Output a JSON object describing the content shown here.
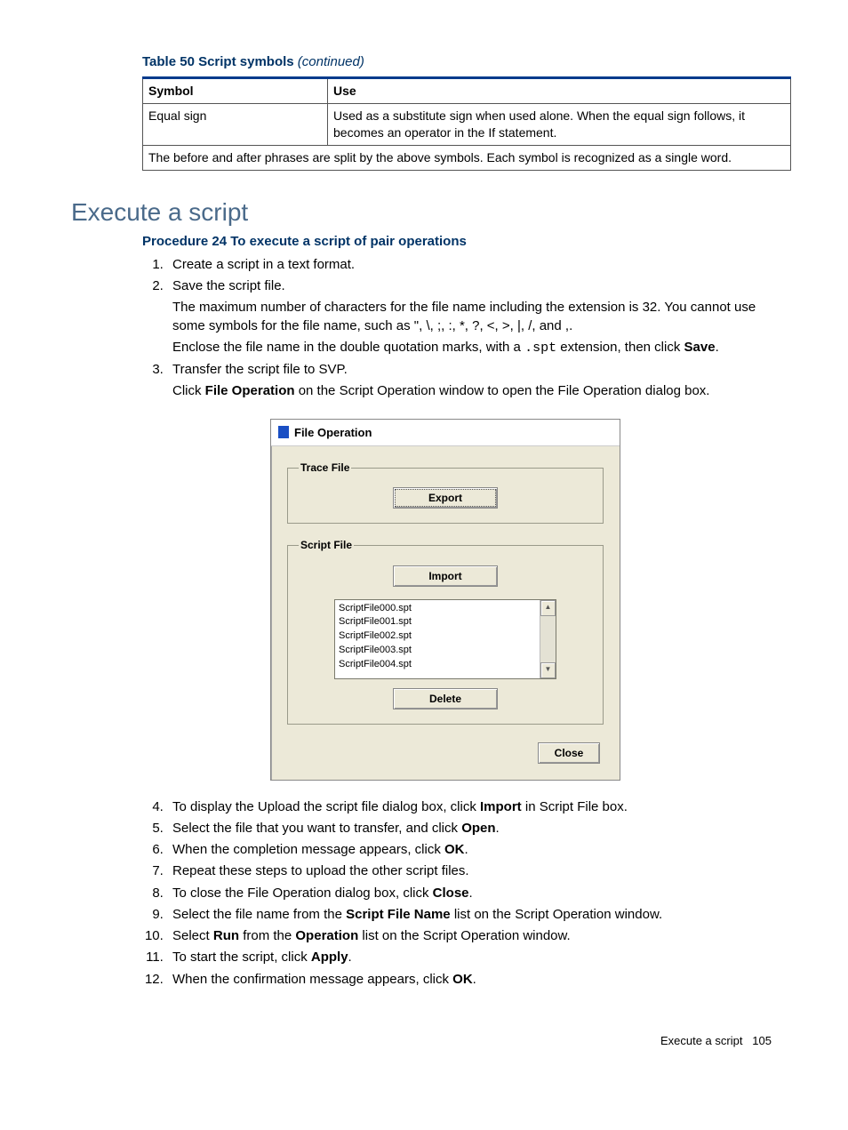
{
  "table": {
    "caption_main": "Table 50 Script symbols ",
    "caption_cont": "(continued)",
    "headers": [
      "Symbol",
      "Use"
    ],
    "rows": [
      {
        "symbol": "Equal sign",
        "use": "Used as a substitute sign when used alone. When the equal sign follows, it becomes an operator in the If statement."
      }
    ],
    "footer": "The before and after phrases are split by the above symbols. Each symbol is recognized as a single word."
  },
  "section_heading": "Execute a script",
  "procedure_title": "Procedure 24 To execute a script of pair operations",
  "steps": {
    "s1": "Create a script in a text format.",
    "s2": "Save the script file.",
    "s2_p1": "The maximum number of characters for the file name including the extension is 32. You cannot use some symbols for the file name, such as \", \\, ;, :, *, ?, <, >, |, /, and ,.",
    "s2_p2a": "Enclose the file name in the double quotation marks, with a ",
    "s2_p2_code": ".spt",
    "s2_p2b": " extension, then click ",
    "s2_p2_bold": "Save",
    "s2_p2c": ".",
    "s3": "Transfer the script file to SVP.",
    "s3_p1a": "Click ",
    "s3_p1_bold": "File Operation",
    "s3_p1b": " on the Script Operation window to open the File Operation dialog box.",
    "s4a": "To display the Upload the script file dialog box, click ",
    "s4_bold": "Import",
    "s4b": " in Script File box.",
    "s5a": "Select the file that you want to transfer, and click ",
    "s5_bold": "Open",
    "s5b": ".",
    "s6a": "When the completion message appears, click ",
    "s6_bold": "OK",
    "s6b": ".",
    "s7": "Repeat these steps to upload the other script files.",
    "s8a": "To close the File Operation dialog box, click ",
    "s8_bold": "Close",
    "s8b": ".",
    "s9a": "Select the file name from the ",
    "s9_bold": "Script File Name",
    "s9b": " list on the Script Operation window.",
    "s10a": "Select ",
    "s10_bold1": "Run",
    "s10b": " from the ",
    "s10_bold2": "Operation",
    "s10c": " list on the Script Operation window.",
    "s11a": "To start the script, click ",
    "s11_bold": "Apply",
    "s11b": ".",
    "s12a": "When the confirmation message appears, click ",
    "s12_bold": "OK",
    "s12b": "."
  },
  "dialog": {
    "title": "File Operation",
    "trace_legend": "Trace File",
    "export_btn": "Export",
    "script_legend": "Script File",
    "import_btn": "Import",
    "files": [
      "ScriptFile000.spt",
      "ScriptFile001.spt",
      "ScriptFile002.spt",
      "ScriptFile003.spt",
      "ScriptFile004.spt"
    ],
    "delete_btn": "Delete",
    "close_btn": "Close"
  },
  "footer": {
    "text": "Execute a script",
    "page": "105"
  }
}
